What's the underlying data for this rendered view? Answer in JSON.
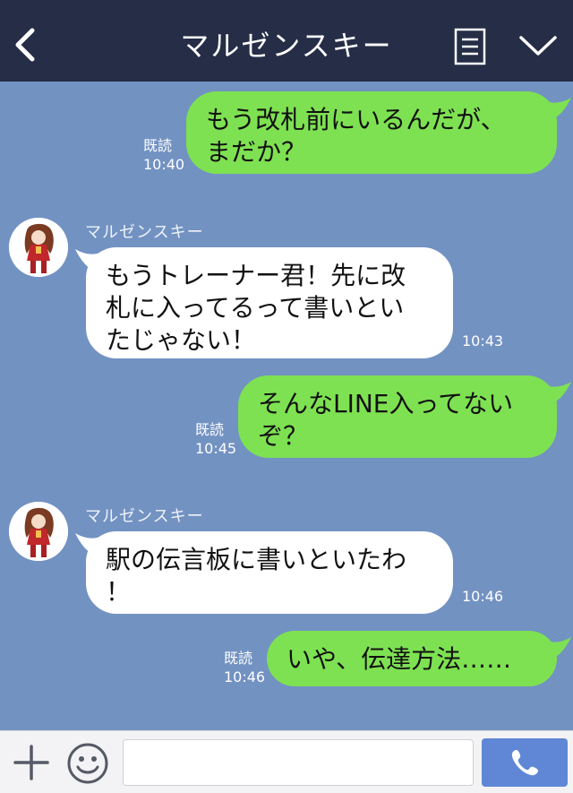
{
  "header": {
    "title": "マルゼンスキー"
  },
  "messages": [
    {
      "side": "out",
      "lines": [
        "もう改札前にいるんだが、",
        "まだか？"
      ],
      "read": "既読",
      "time": "10:40"
    },
    {
      "side": "in",
      "sender": "マルゼンスキー",
      "lines": [
        "もうトレーナー君！先に改",
        "札に入ってるって書いとい",
        "たじゃない！"
      ],
      "time": "10:43"
    },
    {
      "side": "out",
      "lines": [
        "そんなLINE入ってない",
        "ぞ？"
      ],
      "read": "既読",
      "time": "10:45"
    },
    {
      "side": "in",
      "sender": "マルゼンスキー",
      "lines": [
        "駅の伝言板に書いといたわ",
        "！"
      ],
      "time": "10:46"
    },
    {
      "side": "out",
      "lines": [
        "いや、伝達方法……"
      ],
      "read": "既読",
      "time": "10:46"
    }
  ],
  "footer": {
    "input_value": "",
    "input_placeholder": ""
  },
  "icons": [
    "back-icon",
    "menu-icon",
    "chevron-down-icon",
    "plus-icon",
    "smile-icon",
    "phone-icon"
  ],
  "colors": {
    "header": "#252d47",
    "chat_background": "#7292c2",
    "outgoing_bubble": "#7ee152",
    "incoming_bubble": "#ffffff",
    "call_button": "#5f87d6"
  }
}
